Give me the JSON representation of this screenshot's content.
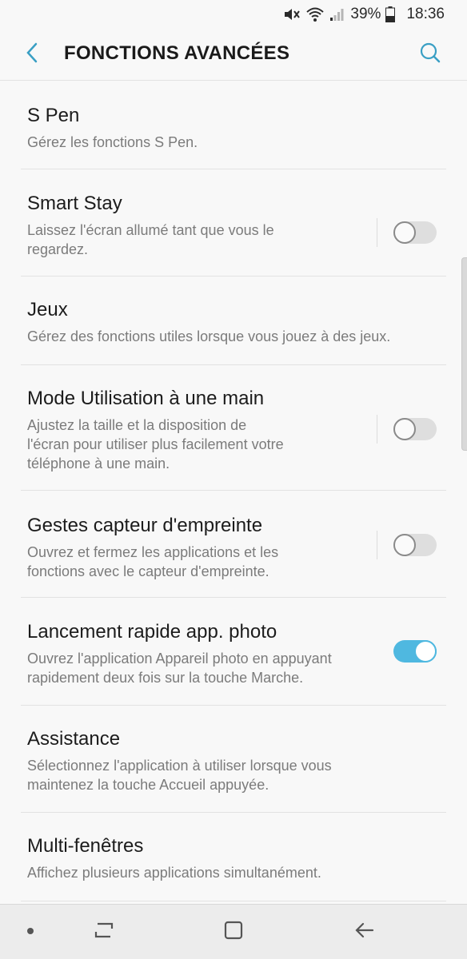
{
  "status_bar": {
    "battery_percent": "39%",
    "time": "18:36",
    "icons": [
      "mute-icon",
      "wifi-icon",
      "signal-icon",
      "battery-icon"
    ]
  },
  "header": {
    "title": "FONCTIONS AVANCÉES",
    "back_icon": "back-arrow-icon",
    "search_icon": "search-icon"
  },
  "items": [
    {
      "title": "S Pen",
      "subtitle": "Gérez les fonctions S Pen."
    },
    {
      "title": "Smart Stay",
      "subtitle_lines": [
        "Laissez l'écran allumé tant que vous le",
        "regardez."
      ],
      "toggle": false
    },
    {
      "title": "Jeux",
      "subtitle": "Gérez des fonctions utiles lorsque vous jouez à des jeux."
    },
    {
      "title": "Mode Utilisation à une main",
      "subtitle_lines": [
        "Ajustez la taille et la disposition de",
        "l'écran pour utiliser plus facilement votre",
        "téléphone à une main."
      ],
      "toggle": false
    },
    {
      "title": "Gestes capteur d'empreinte",
      "subtitle_lines": [
        "Ouvrez et fermez les applications et les",
        "fonctions avec le capteur d'empreinte."
      ],
      "toggle": false
    },
    {
      "title": "Lancement rapide app. photo",
      "subtitle_lines": [
        "Ouvrez l'application Appareil photo en appuyant",
        "rapidement deux fois sur la touche Marche."
      ],
      "toggle": true
    },
    {
      "title": "Assistance",
      "subtitle_lines": [
        "Sélectionnez l'application à utiliser lorsque vous",
        "maintenez la touche Accueil appuyée."
      ]
    },
    {
      "title": "Multi-fenêtres",
      "subtitle": "Affichez plusieurs applications simultanément."
    }
  ],
  "nav_bar": {
    "icons": [
      "dot-icon",
      "recent-apps-icon",
      "home-icon",
      "back-icon"
    ]
  },
  "colors": {
    "accent": "#4fb8e0",
    "header_icon": "#3a9fc4",
    "background": "#f8f8f8"
  }
}
